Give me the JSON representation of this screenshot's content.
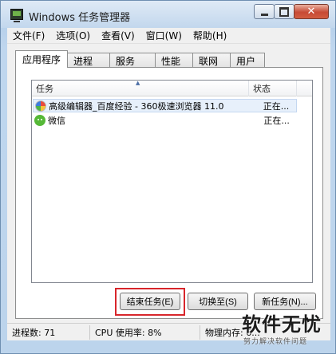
{
  "window": {
    "title": "Windows 任务管理器"
  },
  "menu": [
    "文件(F)",
    "选项(O)",
    "查看(V)",
    "窗口(W)",
    "帮助(H)"
  ],
  "tabs": [
    "应用程序",
    "进程",
    "服务",
    "性能",
    "联网",
    "用户"
  ],
  "active_tab": "应用程序",
  "listview": {
    "columns": [
      "任务",
      "状态"
    ],
    "rows": [
      {
        "name": "高级编辑器_百度经验 - 360极速浏览器 11.0",
        "status": "正在...",
        "icon": "360-browser-icon"
      },
      {
        "name": "微信",
        "status": "正在...",
        "icon": "wechat-icon"
      }
    ]
  },
  "buttons": {
    "end_task": "结束任务(E)",
    "switch_to": "切换至(S)",
    "new_task": "新任务(N)..."
  },
  "statusbar": {
    "processes": "进程数: 71",
    "cpu": "CPU 使用率: 8%",
    "memory": "物理内存: 6..."
  },
  "watermark": {
    "main": "软件无忧",
    "sub": "努力解决软件问题"
  },
  "colors": {
    "highlight_border": "#d8262b",
    "selected_row": "#e7f0fb",
    "frame": "#bcd4ec"
  }
}
